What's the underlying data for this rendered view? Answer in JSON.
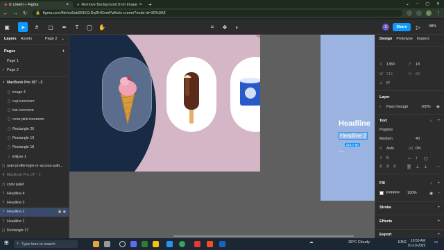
{
  "browser": {
    "tabs": [
      {
        "title": "ic creem – Figma",
        "active": true
      },
      {
        "title": "Remove Background from Image",
        "active": false
      }
    ],
    "url": "figma.com/file/eo5ob5INXCrDqRHGvmPaAo/ic-creem?node-id=30%3A2"
  },
  "toolbar": {
    "share_label": "Share",
    "zoom": "48%",
    "avatar_initial": "S"
  },
  "left_panel": {
    "tabs": {
      "layers": "Layers",
      "assets": "Assets",
      "page": "Page 2"
    },
    "pages_title": "Pages",
    "pages": [
      "Page 1",
      "Page 2"
    ],
    "layers": [
      {
        "icon": "#",
        "label": "MacBook Pro 16\" - 2",
        "indent": 0,
        "bold": true
      },
      {
        "icon": "▢",
        "label": "image 4",
        "indent": 1
      },
      {
        "icon": "▢",
        "label": "cup icecreem",
        "indent": 1
      },
      {
        "icon": "▢",
        "label": "bar icecreem",
        "indent": 1
      },
      {
        "icon": "▢",
        "label": "cone pink icecreem",
        "indent": 1
      },
      {
        "icon": "▢",
        "label": "Rectangle 20",
        "indent": 1
      },
      {
        "icon": "▢",
        "label": "Rectangle 19",
        "indent": 1
      },
      {
        "icon": "▢",
        "label": "Rectangle 18",
        "indent": 1
      },
      {
        "icon": "○",
        "label": "Ellipse 1",
        "indent": 1
      },
      {
        "icon": "▢",
        "label": "user-profile-login-or-access-auth...",
        "indent": 0
      },
      {
        "icon": "#",
        "label": "MacBook Pro 16\" - 1",
        "indent": 0,
        "dim": true
      },
      {
        "icon": "▢",
        "label": "color palet",
        "indent": 0
      },
      {
        "icon": "T",
        "label": "Headline 4",
        "indent": 0
      },
      {
        "icon": "T",
        "label": "Headline 3",
        "indent": 0
      },
      {
        "icon": "T",
        "label": "Headline 2",
        "indent": 0,
        "selected": true
      },
      {
        "icon": "T",
        "label": "Headline 1",
        "indent": 0
      },
      {
        "icon": "▢",
        "label": "Rectangle 17",
        "indent": 0
      }
    ]
  },
  "canvas": {
    "headline_big": "Headline",
    "headline_sel": "Headline 2",
    "dim_tag": "213 × 60",
    "caption_a": "Hea",
    "scribble": "ᶜ/"
  },
  "right_panel": {
    "tabs": {
      "design": "Design",
      "prototype": "Prototype",
      "inspect": "Inspect"
    },
    "x_label": "X",
    "x_value": "1380",
    "y_label": "Y",
    "y_value": "18",
    "w_label": "W",
    "w_value": "213",
    "h_label": "H",
    "h_value": "60",
    "rot_value": "0°",
    "layer_title": "Layer",
    "blend": "Pass through",
    "opacity": "100%",
    "text_title": "Text",
    "font_family": "Poppins",
    "font_weight": "Medium",
    "font_size": "40",
    "line_height": "Auto",
    "letter_spacing": "0%",
    "para_spacing": "0",
    "fill_title": "Fill",
    "fill_hex": "FFFFFF",
    "fill_opacity": "100%",
    "stroke_title": "Stroke",
    "effects_title": "Effects",
    "export_title": "Export"
  },
  "taskbar": {
    "search_placeholder": "Type here to search",
    "weather": "28°C Cloudy",
    "lang": "ENG",
    "time": "10:50 AM",
    "date": "01-10-2022"
  }
}
